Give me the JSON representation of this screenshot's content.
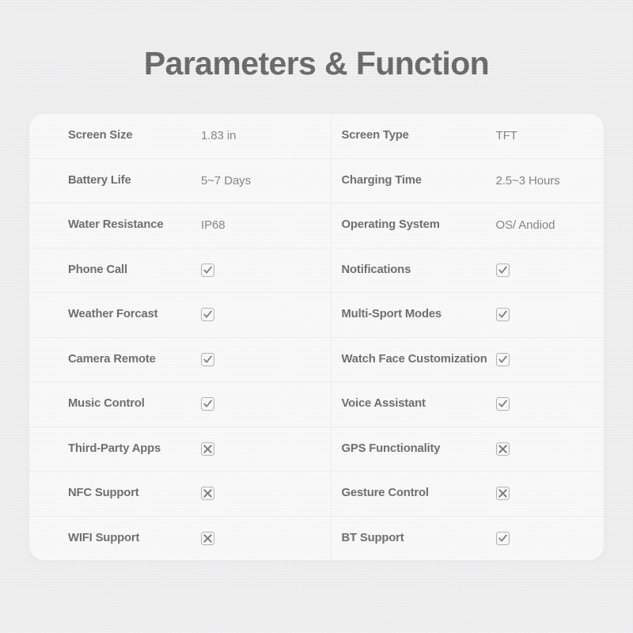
{
  "page": {
    "title": "Parameters & Function",
    "background_color": "#eeeeef",
    "card_color": "#ffffff"
  },
  "spec_table": {
    "rows": [
      {
        "left": {
          "label": "Screen Size",
          "value": "1.83 in",
          "type": "text"
        },
        "right": {
          "label": "Screen Type",
          "value": "TFT",
          "type": "text"
        }
      },
      {
        "left": {
          "label": "Battery Life",
          "value": "5~7 Days",
          "type": "text"
        },
        "right": {
          "label": "Charging Time",
          "value": "2.5~3 Hours",
          "type": "text"
        }
      },
      {
        "left": {
          "label": "Water Resistance",
          "value": "IP68",
          "type": "text"
        },
        "right": {
          "label": "Operating System",
          "value": "OS/ Andiod",
          "type": "text"
        }
      },
      {
        "left": {
          "label": "Phone Call",
          "value": "check",
          "type": "mark"
        },
        "right": {
          "label": "Notifications",
          "value": "check",
          "type": "mark"
        }
      },
      {
        "left": {
          "label": "Weather Forcast",
          "value": "check",
          "type": "mark"
        },
        "right": {
          "label": "Multi-Sport Modes",
          "value": "check",
          "type": "mark"
        }
      },
      {
        "left": {
          "label": "Camera Remote",
          "value": "check",
          "type": "mark"
        },
        "right": {
          "label": "Watch Face Customization",
          "value": "check",
          "type": "mark"
        }
      },
      {
        "left": {
          "label": "Music Control",
          "value": "check",
          "type": "mark"
        },
        "right": {
          "label": "Voice Assistant",
          "value": "check",
          "type": "mark"
        }
      },
      {
        "left": {
          "label": "Third-Party Apps",
          "value": "cross",
          "type": "mark"
        },
        "right": {
          "label": "GPS Functionality",
          "value": "cross",
          "type": "mark"
        }
      },
      {
        "left": {
          "label": "NFC Support",
          "value": "cross",
          "type": "mark"
        },
        "right": {
          "label": "Gesture Control",
          "value": "cross",
          "type": "mark"
        }
      },
      {
        "left": {
          "label": "WIFI Support",
          "value": "cross",
          "type": "mark"
        },
        "right": {
          "label": "BT Support",
          "value": "check",
          "type": "mark"
        }
      }
    ]
  }
}
